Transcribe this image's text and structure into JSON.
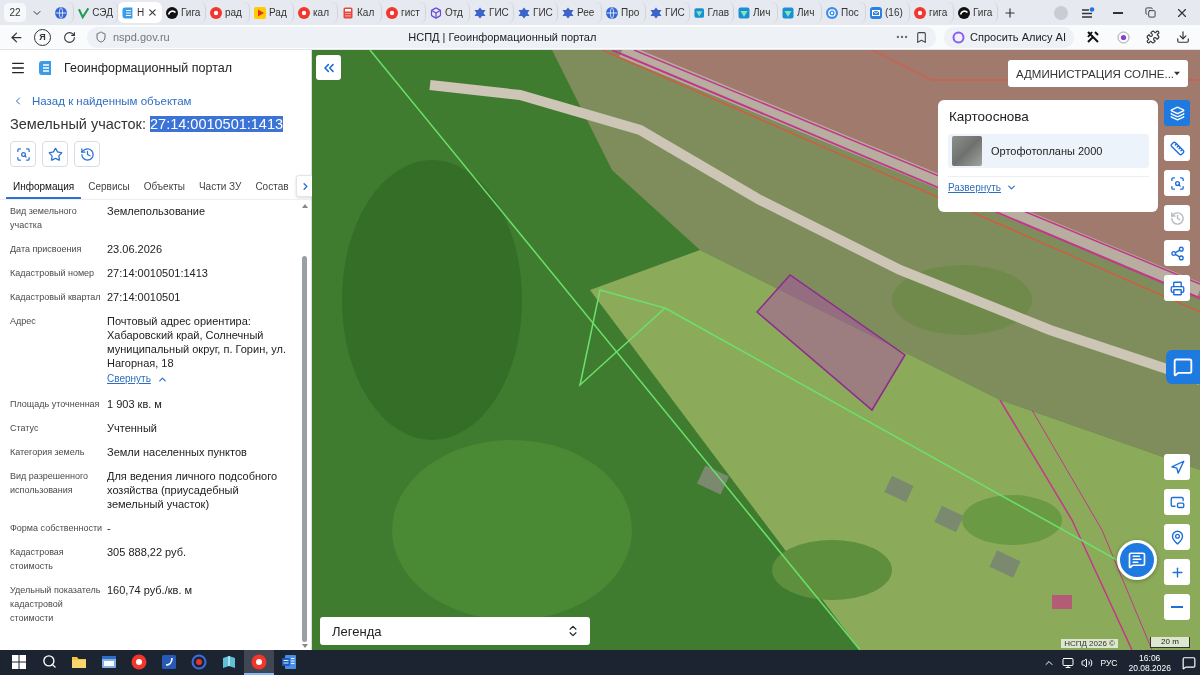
{
  "browser": {
    "tab_count": "22",
    "tabs": [
      {
        "kind": "globe",
        "selected": false
      },
      {
        "kind": "check",
        "title": "СЭД",
        "selected": false
      },
      {
        "kind": "portal",
        "title": "Н",
        "selected": true
      },
      {
        "kind": "orb",
        "title": "Гига",
        "selected": false
      },
      {
        "kind": "round",
        "title": "рад",
        "selected": false
      },
      {
        "kind": "play",
        "title": "Рад",
        "selected": false
      },
      {
        "kind": "round",
        "title": "кал",
        "selected": false
      },
      {
        "kind": "calculator",
        "title": "Кал",
        "selected": false
      },
      {
        "kind": "round",
        "title": "гист",
        "selected": false
      },
      {
        "kind": "cube",
        "title": "Отд",
        "selected": false
      },
      {
        "kind": "emblem",
        "title": "ГИС",
        "selected": false
      },
      {
        "kind": "emblem",
        "title": "ГИС",
        "selected": false
      },
      {
        "kind": "emblem",
        "title": "Рее",
        "selected": false
      },
      {
        "kind": "globe",
        "title": "Про",
        "selected": false
      },
      {
        "kind": "emblem",
        "title": "ГИС",
        "selected": false
      },
      {
        "kind": "diamond",
        "title": "Глав",
        "selected": false
      },
      {
        "kind": "diamond",
        "title": "Лич",
        "selected": false
      },
      {
        "kind": "diamond",
        "title": "Лич",
        "selected": false
      },
      {
        "kind": "at",
        "title": "Пос",
        "selected": false
      },
      {
        "kind": "mail",
        "title": "(16)",
        "selected": false
      },
      {
        "kind": "round",
        "title": "гига",
        "selected": false
      },
      {
        "kind": "orb",
        "title": "Гига",
        "selected": false
      }
    ],
    "home_button": "Я",
    "url": "nspd.gov.ru",
    "page_title": "НСПД | Геоинформационный портал",
    "alice_button": "Спросить Алису AI"
  },
  "panel": {
    "app_title": "Геоинформационный портал",
    "back_link": "Назад к найденным объектам",
    "object_title": {
      "prefix": "Земельный участок:",
      "number": "27:14:0010501:1413",
      "number_selected": true
    },
    "tabs": [
      {
        "label": "Информация",
        "selected": true
      },
      {
        "label": "Сервисы",
        "selected": false
      },
      {
        "label": "Объекты",
        "selected": false
      },
      {
        "label": "Части ЗУ",
        "selected": false
      },
      {
        "label": "Состав",
        "selected": false
      }
    ],
    "properties": [
      {
        "label": "Вид земельного участка",
        "value": "Землепользование"
      },
      {
        "label": "Дата присвоения",
        "value": "23.06.2026"
      },
      {
        "label": "Кадастровый номер",
        "value": "27:14:0010501:1413"
      },
      {
        "label": "Кадастровый квартал",
        "value": "27:14:0010501"
      },
      {
        "label": "Адрес",
        "value": "Почтовый адрес ориентира: Хабаровский край, Солнечный муниципальный округ, п. Горин, ул. Нагорная, 18",
        "toggle": {
          "label": "Свернуть",
          "expanded": true
        }
      },
      {
        "label": "Площадь уточненная",
        "value": "1 903 кв. м"
      },
      {
        "label": "Статус",
        "value": "Учтенный"
      },
      {
        "label": "Категория земель",
        "value": "Земли населенных пунктов"
      },
      {
        "label": "Вид разрешенного использования",
        "value": "Для ведения личного подсобного хозяйства (приусадебный земельный участок)"
      },
      {
        "label": "Форма собственности",
        "value": "-"
      },
      {
        "label": "Кадастровая стоимость",
        "value": "305 888,22 руб."
      },
      {
        "label": "Удельный показатель кадастровой стоимости",
        "value": "160,74 руб./кв. м"
      }
    ]
  },
  "map": {
    "region_select": "АДМИНИСТРАЦИЯ СОЛНЕ...",
    "basemap": {
      "title": "Картооснова",
      "layer": "Ортофотопланы 2000",
      "expand_link": "Развернуть"
    },
    "tools": [
      {
        "kind": "layers",
        "selected": true,
        "disabled": false
      },
      {
        "kind": "ruler",
        "selected": false,
        "disabled": false
      },
      {
        "kind": "area-search",
        "selected": false,
        "disabled": false
      },
      {
        "kind": "history",
        "selected": false,
        "disabled": true
      },
      {
        "kind": "share",
        "selected": false,
        "disabled": false
      },
      {
        "kind": "print",
        "selected": false,
        "disabled": false
      }
    ],
    "nav_tools": [
      {
        "kind": "navigate"
      },
      {
        "kind": "minimap"
      },
      {
        "kind": "location"
      },
      {
        "kind": "zoom-in"
      },
      {
        "kind": "zoom-out"
      }
    ],
    "legend": "Легенда",
    "attribution": "НСПД 2026 ©",
    "scale": "20 m"
  },
  "taskbar": {
    "apps": [
      {
        "kind": "start",
        "selected": false
      },
      {
        "kind": "search",
        "selected": false
      },
      {
        "kind": "folder",
        "selected": false
      },
      {
        "kind": "window",
        "selected": false
      },
      {
        "kind": "round",
        "selected": false
      },
      {
        "kind": "note",
        "selected": false
      },
      {
        "kind": "disc",
        "selected": false
      },
      {
        "kind": "book",
        "selected": false
      },
      {
        "kind": "round",
        "selected": true
      },
      {
        "kind": "document",
        "selected": false
      }
    ],
    "language": "РУС",
    "time": "16:06",
    "date": "20.08.2026"
  }
}
